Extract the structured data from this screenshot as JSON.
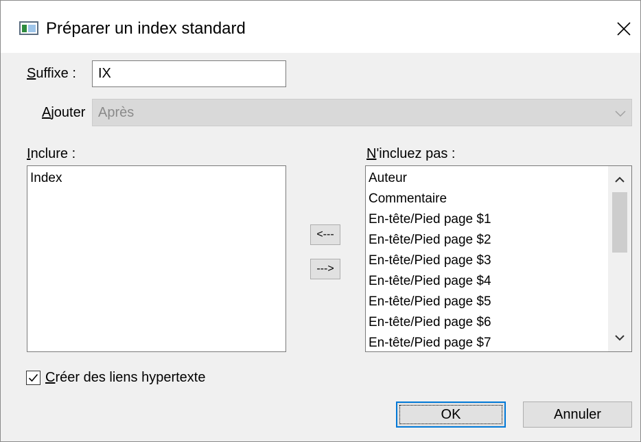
{
  "dialog": {
    "title": "Préparer un index standard",
    "close_glyph": "✕",
    "app_icon": "window-app-icon"
  },
  "suffix": {
    "label_mnemonic": "S",
    "label_rest": "uffixe :",
    "value": "IX"
  },
  "add": {
    "label_mnemonic": "A",
    "label_rest": "jouter",
    "selected": "Après",
    "disabled": true
  },
  "include": {
    "label_mnemonic": "I",
    "label_rest": "nclure :",
    "items": [
      "Index"
    ]
  },
  "exclude": {
    "label_mnemonic": "N",
    "label_rest": "'incluez pas :",
    "items": [
      "Auteur",
      "Commentaire",
      "En-tête/Pied page $1",
      "En-tête/Pied page $2",
      "En-tête/Pied page $3",
      "En-tête/Pied page $4",
      "En-tête/Pied page $5",
      "En-tête/Pied page $6",
      "En-tête/Pied page $7"
    ]
  },
  "move": {
    "left_label": "<---",
    "right_label": "--->"
  },
  "hyperlinks": {
    "label_mnemonic": "C",
    "label_rest": "réer des liens hypertexte",
    "checked": true
  },
  "buttons": {
    "ok": "OK",
    "cancel": "Annuler"
  },
  "colors": {
    "accent": "#0078d7",
    "window_bg": "#f0f0f0",
    "disabled_bg": "#d9d9d9"
  }
}
